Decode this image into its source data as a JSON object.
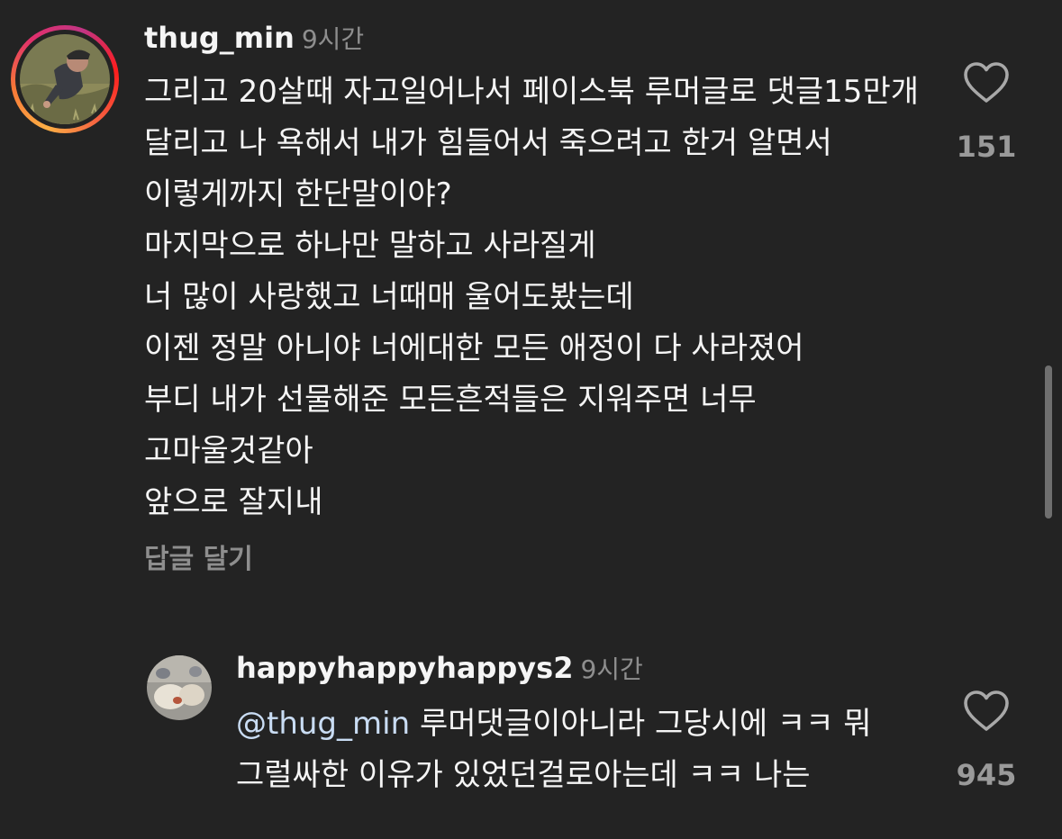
{
  "comments": [
    {
      "username": "thug_min",
      "time": "9시간",
      "lines": [
        "그리고 20살때 자고일어나서 페이스북 루머글로 댓글15만개 달리고 나 욕해서 내가 힘들어서 죽으려고 한거 알면서 이렇게까지 한단말이야?",
        "마지막으로 하나만 말하고 사라질게",
        "너 많이 사랑했고 너때매 울어도봤는데",
        "이젠 정말 아니야 너에대한 모든 애정이 다 사라졌어",
        "부디 내가 선물해준 모든흔적들은 지워주면 너무 고마울것같아",
        "앞으로 잘지내"
      ],
      "reply_label": "답글 달기",
      "likes": "151",
      "like_icon": "heart-outline-icon"
    },
    {
      "username": "happyhappyhappys2",
      "time": "9시간",
      "mention": "@thug_min",
      "text": " 루머댓글이아니라 그당시에 ㅋㅋ 뭐 그럴싸한 이유가 있었던걸로아는데 ㅋㅋ 나는",
      "likes": "945",
      "like_icon": "heart-outline-icon"
    }
  ],
  "colors": {
    "background": "#232323",
    "text": "#f5f5f5",
    "secondary": "#8e8e8e",
    "mention": "#c9dcf3"
  }
}
